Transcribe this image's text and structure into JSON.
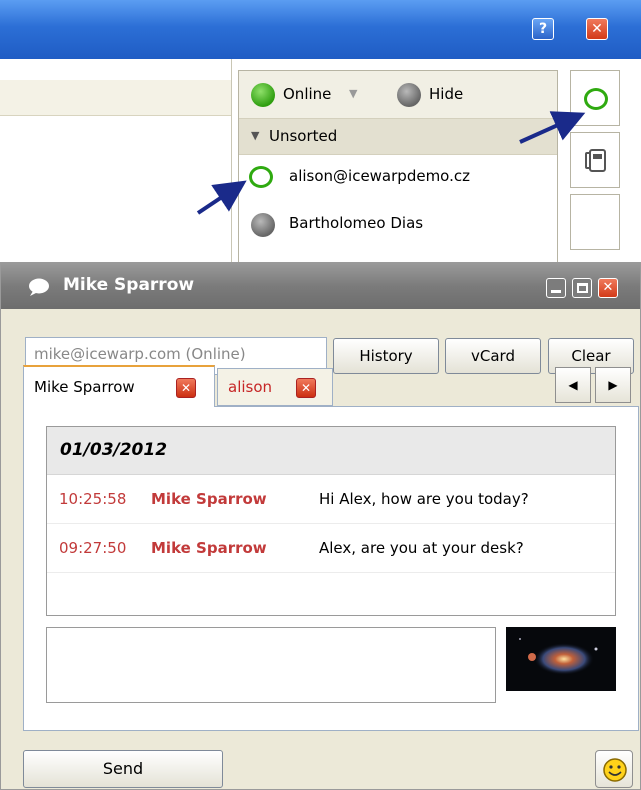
{
  "window": {
    "help_label": "?",
    "close_label": "✕"
  },
  "contacts": {
    "status_label": "Online",
    "hide_label": "Hide",
    "group_label": "Unsorted",
    "items": [
      {
        "name": "alison@icewarpdemo.cz",
        "status": "chat-online"
      },
      {
        "name": "Bartholomeo Dias",
        "status": "offline"
      }
    ]
  },
  "chat": {
    "title": "Mike Sparrow",
    "address_placeholder": "mike@icewarp.com (Online)",
    "history_label": "History",
    "vcard_label": "vCard",
    "clear_label": "Clear",
    "tabs": [
      {
        "label": "Mike Sparrow",
        "close": "✕"
      },
      {
        "label": "alison",
        "close": "✕"
      }
    ],
    "date": "01/03/2012",
    "messages": [
      {
        "time": "10:25:58",
        "from": "Mike Sparrow",
        "text": "Hi Alex, how are you today?"
      },
      {
        "time": "09:27:50",
        "from": "Mike Sparrow",
        "text": "Alex, are you at your desk?"
      }
    ],
    "send_label": "Send",
    "close_label": "✕"
  },
  "colors": {
    "accent_red": "#c23a3a",
    "online_green": "#2f9e10",
    "title_blue": "#2c6fd6"
  }
}
